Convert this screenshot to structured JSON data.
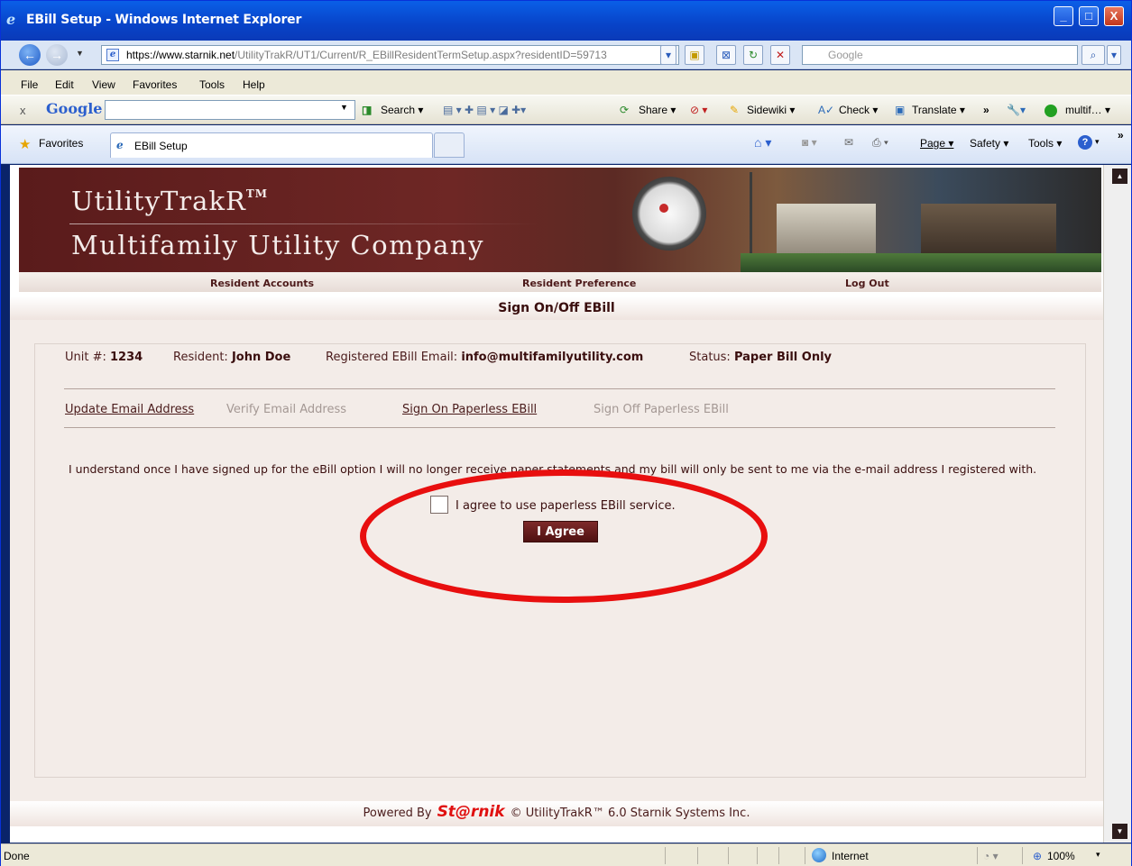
{
  "window": {
    "title": "EBill Setup - Windows Internet Explorer",
    "minimize": "_",
    "maximize": "□",
    "close": "X"
  },
  "address_bar": {
    "url_domain": "https://www.starnik.net",
    "url_path": "/UtilityTrakR/UT1/Current/R_EBillResidentTermSetup.aspx?residentID=59713",
    "search_placeholder": "Google"
  },
  "menu": [
    "File",
    "Edit",
    "View",
    "Favorites",
    "Tools",
    "Help"
  ],
  "google_toolbar": {
    "close": "x",
    "logo": "Google",
    "items": [
      "Search ▾",
      "Share ▾",
      "Sidewiki ▾",
      "Check ▾",
      "Translate ▾",
      "»",
      "multif… ▾"
    ]
  },
  "favorites_bar": {
    "favorites_label": "Favorites",
    "tab_title": "EBill Setup",
    "commands": [
      "Page ▾",
      "Safety ▾",
      "Tools ▾"
    ]
  },
  "site": {
    "brand": "UtilityTrakR",
    "brand_tm": "TM",
    "company": "Multifamily Utility Company",
    "nav": [
      "Resident Accounts",
      "Resident Preference",
      "Log Out"
    ],
    "heading": "Sign On/Off EBill"
  },
  "resident": {
    "unit_label": "Unit #:",
    "unit_value": "1234",
    "resident_label": "Resident:",
    "resident_value": "John Doe",
    "email_label": "Registered EBill Email:",
    "email_value": "info@multifamilyutility.com",
    "status_label": "Status:",
    "status_value": "Paper Bill Only"
  },
  "actions": {
    "update_email": "Update Email Address",
    "verify_email": "Verify Email Address",
    "sign_on": "Sign On Paperless EBill",
    "sign_off": "Sign Off Paperless EBill"
  },
  "terms": {
    "text": "I understand once I have signed up for the eBill option I will no longer receive paper statements and my bill will only be sent to me via the e-mail address I registered with.",
    "checkbox_label": "I agree to use paperless EBill service.",
    "button": "I Agree",
    "checked": false
  },
  "footer": {
    "powered_by": "Powered By",
    "brand": "St@rnik",
    "rest": "© UtilityTrakR™ 6.0 Starnik Systems Inc."
  },
  "status_bar": {
    "status": "Done",
    "zone": "Internet",
    "zoom": "100%"
  }
}
